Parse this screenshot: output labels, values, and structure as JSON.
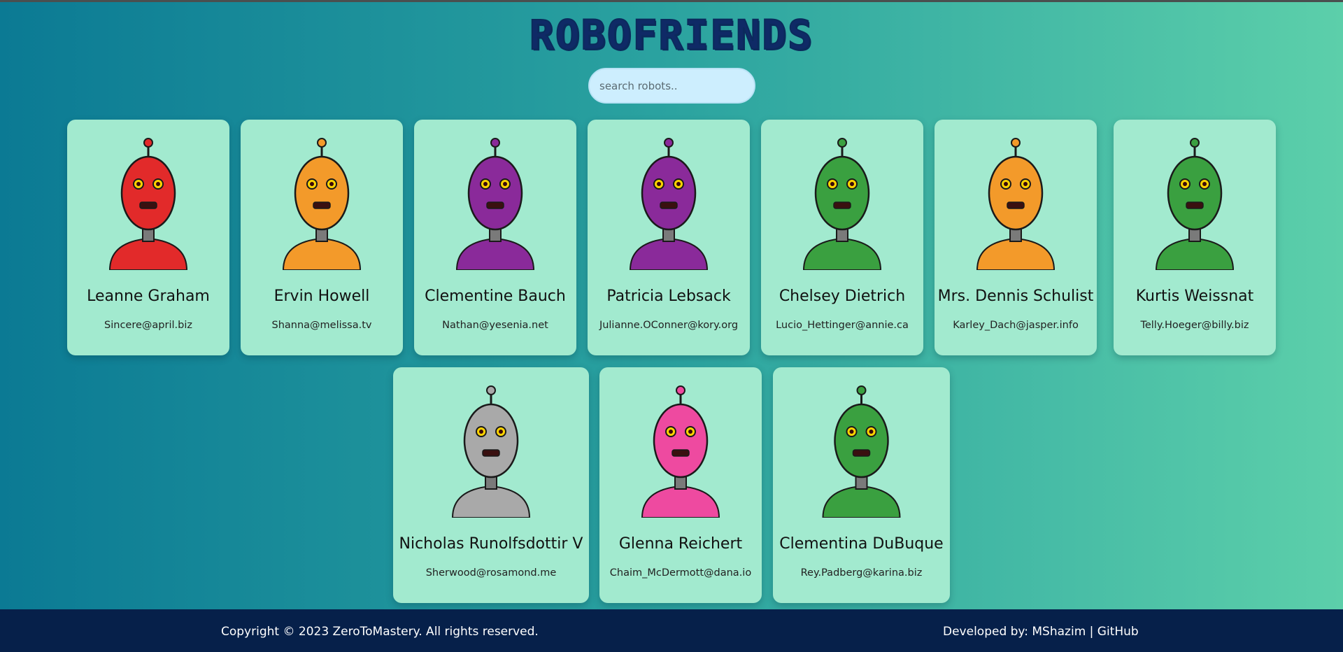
{
  "app": {
    "logo": "ROBOFRIENDS"
  },
  "search": {
    "placeholder": "search robots.."
  },
  "robots": [
    {
      "name": "Leanne Graham",
      "email": "Sincere@april.biz",
      "color": "#e22a2a"
    },
    {
      "name": "Ervin Howell",
      "email": "Shanna@melissa.tv",
      "color": "#f39a2a"
    },
    {
      "name": "Clementine Bauch",
      "email": "Nathan@yesenia.net",
      "color": "#8a2a9a"
    },
    {
      "name": "Patricia Lebsack",
      "email": "Julianne.OConner@kory.org",
      "color": "#8a2a9a"
    },
    {
      "name": "Chelsey Dietrich",
      "email": "Lucio_Hettinger@annie.ca",
      "color": "#3aa040"
    },
    {
      "name": "Mrs. Dennis Schulist",
      "email": "Karley_Dach@jasper.info",
      "color": "#f39a2a"
    },
    {
      "name": "Kurtis Weissnat",
      "email": "Telly.Hoeger@billy.biz",
      "color": "#3aa040"
    },
    {
      "name": "Nicholas Runolfsdottir V",
      "email": "Sherwood@rosamond.me",
      "color": "#a9a9a9"
    },
    {
      "name": "Glenna Reichert",
      "email": "Chaim_McDermott@dana.io",
      "color": "#ee4aa0"
    },
    {
      "name": "Clementina DuBuque",
      "email": "Rey.Padberg@karina.biz",
      "color": "#3aa040"
    }
  ],
  "footer": {
    "copyright": "Copyright © 2023 ZeroToMastery. All rights reserved.",
    "developed_prefix": "Developed by: ",
    "developer_link": "MShazim",
    "separator": " | ",
    "github_link": "GitHub"
  }
}
